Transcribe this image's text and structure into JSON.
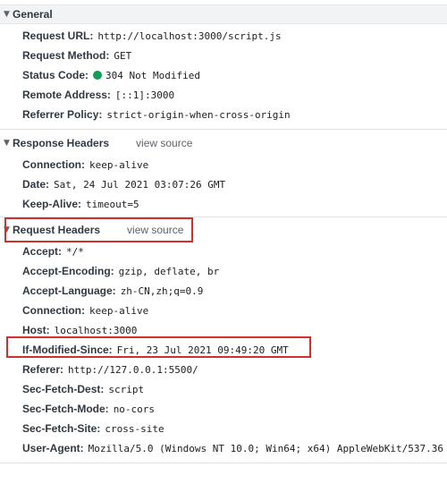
{
  "general": {
    "title": "General",
    "rows": [
      {
        "key": "Request URL:",
        "value": "http://localhost:3000/script.js"
      },
      {
        "key": "Request Method:",
        "value": "GET"
      },
      {
        "key": "Status Code:",
        "value": "304 Not Modified"
      },
      {
        "key": "Remote Address:",
        "value": "[::1]:3000"
      },
      {
        "key": "Referrer Policy:",
        "value": "strict-origin-when-cross-origin"
      }
    ]
  },
  "response_headers": {
    "title": "Response Headers",
    "view_source": "view source",
    "rows": [
      {
        "key": "Connection:",
        "value": "keep-alive"
      },
      {
        "key": "Date:",
        "value": "Sat, 24 Jul 2021 03:07:26 GMT"
      },
      {
        "key": "Keep-Alive:",
        "value": "timeout=5"
      }
    ]
  },
  "request_headers": {
    "title": "Request Headers",
    "view_source": "view source",
    "rows": [
      {
        "key": "Accept:",
        "value": "*/*"
      },
      {
        "key": "Accept-Encoding:",
        "value": "gzip, deflate, br"
      },
      {
        "key": "Accept-Language:",
        "value": "zh-CN,zh;q=0.9"
      },
      {
        "key": "Connection:",
        "value": "keep-alive"
      },
      {
        "key": "Host:",
        "value": "localhost:3000"
      },
      {
        "key": "If-Modified-Since:",
        "value": "Fri, 23 Jul 2021 09:49:20 GMT"
      },
      {
        "key": "Referer:",
        "value": "http://127.0.0.1:5500/"
      },
      {
        "key": "Sec-Fetch-Dest:",
        "value": "script"
      },
      {
        "key": "Sec-Fetch-Mode:",
        "value": "no-cors"
      },
      {
        "key": "Sec-Fetch-Site:",
        "value": "cross-site"
      },
      {
        "key": "User-Agent:",
        "value": "Mozilla/5.0 (Windows NT 10.0; Win64; x64) AppleWebKit/537.36"
      }
    ]
  },
  "icons": {
    "expanded": "▼"
  },
  "colors": {
    "status_ok": "#0f9d58",
    "highlight_box": "#d0312d",
    "link_gray": "#5f6368"
  }
}
